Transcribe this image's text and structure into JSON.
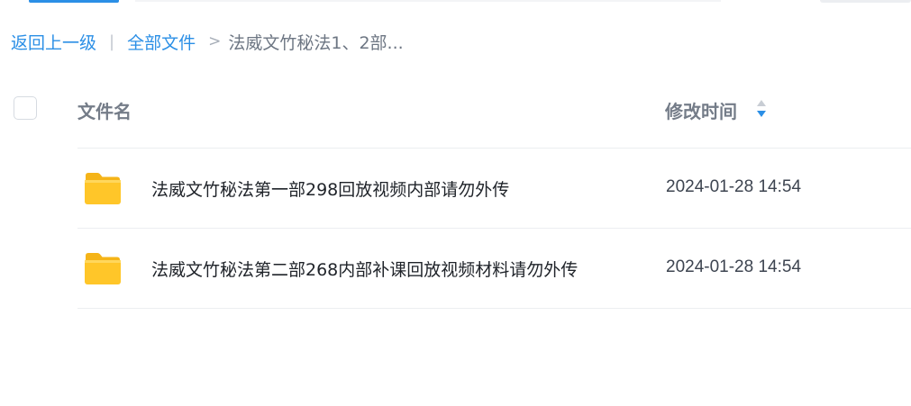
{
  "breadcrumb": {
    "back_label": "返回上一级",
    "separator": "|",
    "all_files_label": "全部文件",
    "arrow": ">",
    "current_label": "法威文竹秘法1、2部..."
  },
  "table": {
    "headers": {
      "name": "文件名",
      "modified_time": "修改时间"
    },
    "rows": [
      {
        "icon": "folder-icon",
        "name": "法威文竹秘法第一部298回放视频内部请勿外传",
        "modified_time": "2024-01-28 14:54"
      },
      {
        "icon": "folder-icon",
        "name": "法威文竹秘法第二部268内部补课回放视频材料请勿外传",
        "modified_time": "2024-01-28 14:54"
      }
    ]
  },
  "colors": {
    "accent": "#2b8fe6",
    "folder_yellow": "#ffc629"
  }
}
